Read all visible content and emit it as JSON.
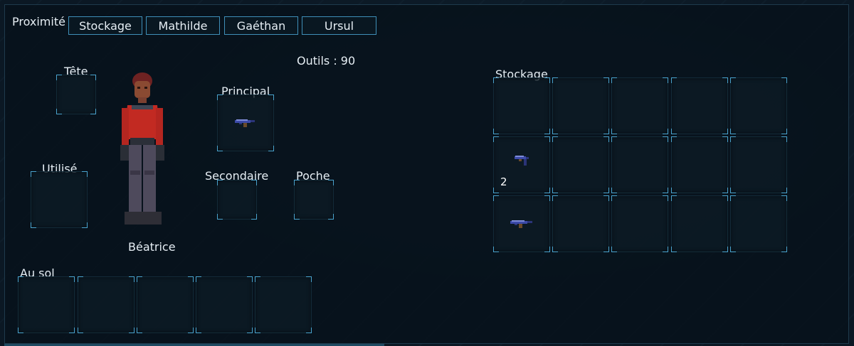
{
  "header": {
    "proximity_label": "Proximité",
    "tabs": [
      {
        "label": "Stockage"
      },
      {
        "label": "Mathilde"
      },
      {
        "label": "Gaéthan"
      },
      {
        "label": "Ursul"
      }
    ]
  },
  "character": {
    "name": "Béatrice",
    "tools_label": "Outils : 90",
    "slots": {
      "head": "Tête",
      "used": "Utilisé",
      "primary": "Principal",
      "secondary": "Secondaire",
      "pocket": "Poche"
    },
    "primary_item_icon": "pistol-icon"
  },
  "ground": {
    "label": "Au sol",
    "slot_count": 5
  },
  "storage": {
    "label": "Stockage",
    "rows": 3,
    "cols": 5,
    "items": [
      {
        "row": 1,
        "col": 0,
        "icon": "pistol-icon",
        "quantity": "2"
      },
      {
        "row": 2,
        "col": 0,
        "icon": "pistol-icon",
        "quantity": ""
      }
    ]
  },
  "colors": {
    "slot_corner": "#4aa4cf",
    "tab_border": "#3f8fb8",
    "panel_bg": "#08121c"
  }
}
